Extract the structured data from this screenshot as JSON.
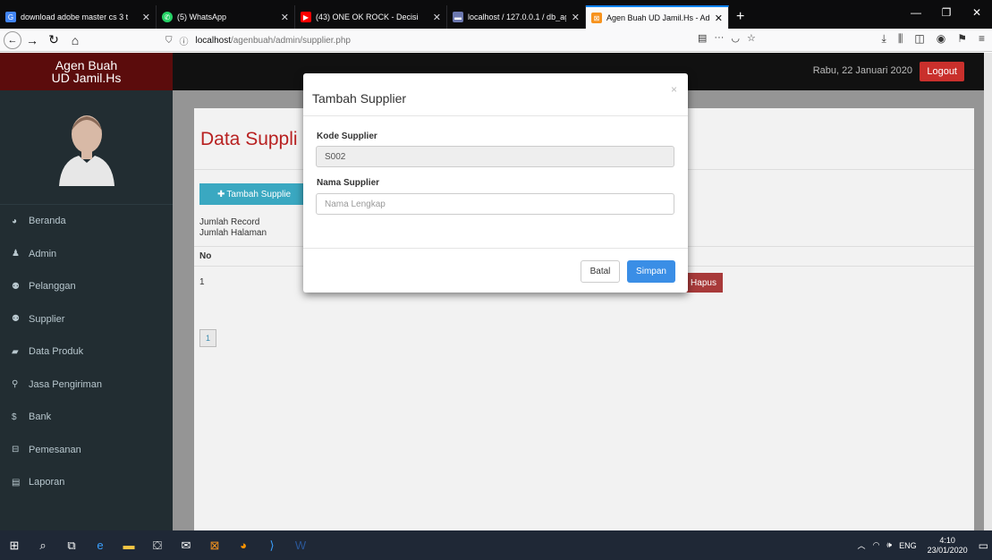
{
  "browser": {
    "tabs": [
      {
        "label": "download adobe master cs 3 t",
        "color": "#4285f4",
        "active": false
      },
      {
        "label": "(5) WhatsApp",
        "color": "#25d366",
        "active": false
      },
      {
        "label": "(43) ONE OK ROCK - Decisi",
        "color": "#ff0000",
        "active": false
      },
      {
        "label": "localhost / 127.0.0.1 / db_agen",
        "color": "#6c78af",
        "active": false
      },
      {
        "label": "Agen Buah UD Jamil.Hs - Adm",
        "color": "#f7931e",
        "active": true
      }
    ],
    "url_host": "localhost",
    "url_path": "/agenbuah/admin/supplier.php"
  },
  "header": {
    "logo_line1": "Agen Buah",
    "logo_line2": "UD Jamil.Hs",
    "date": "Rabu, 22 Januari 2020",
    "logout_label": "Logout"
  },
  "sidebar": {
    "items": [
      {
        "label": "Beranda",
        "icon": "dashboard-icon"
      },
      {
        "label": "Admin",
        "icon": "user-icon"
      },
      {
        "label": "Pelanggan",
        "icon": "users-icon"
      },
      {
        "label": "Supplier",
        "icon": "users-icon"
      },
      {
        "label": "Data Produk",
        "icon": "folder-icon"
      },
      {
        "label": "Jasa Pengiriman",
        "icon": "map-marker-icon"
      },
      {
        "label": "Bank",
        "icon": "dollar-icon"
      },
      {
        "label": "Pemesanan",
        "icon": "inbox-icon"
      },
      {
        "label": "Laporan",
        "icon": "list-icon"
      }
    ]
  },
  "main": {
    "title": "Data Suppli",
    "add_button": "Tambah Supplie",
    "record_label": "Jumlah Record",
    "page_label": "Jumlah Halaman",
    "col_no": "No",
    "row_no": "1",
    "delete_button": "Hapus",
    "page_number": "1"
  },
  "modal": {
    "title": "Tambah Supplier",
    "close": "×",
    "kode_label": "Kode Supplier",
    "kode_value": "S002",
    "nama_label": "Nama Supplier",
    "nama_placeholder": "Nama Lengkap",
    "cancel_label": "Batal",
    "save_label": "Simpan"
  },
  "taskbar": {
    "lang": "ENG",
    "time": "4:10",
    "date": "23/01/2020"
  }
}
